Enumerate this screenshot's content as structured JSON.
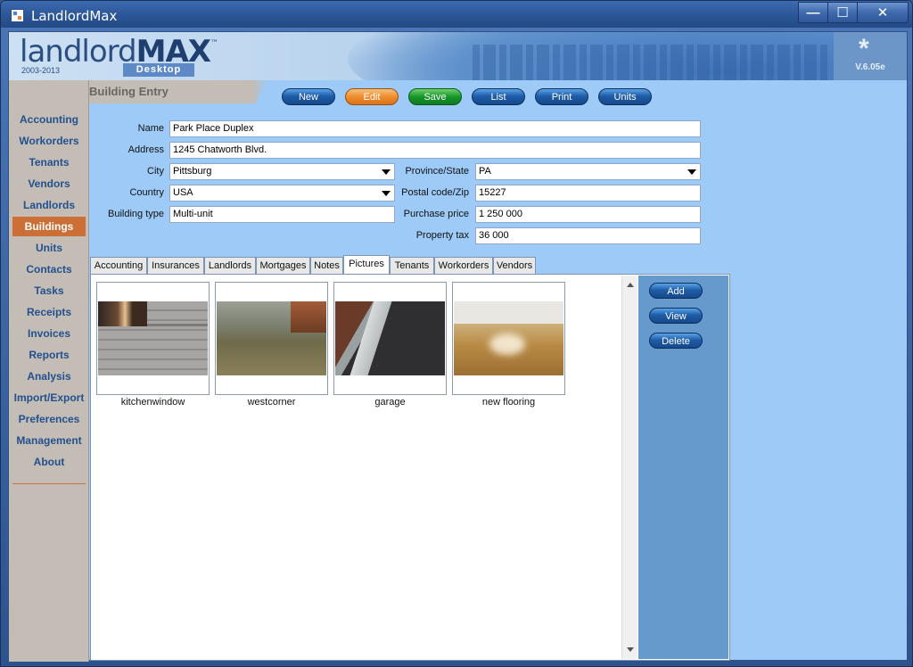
{
  "window": {
    "title": "LandlordMax",
    "minimize": "—",
    "maximize": "☐",
    "close": "✕"
  },
  "banner": {
    "logo_light": "landlord",
    "logo_bold": "MAX",
    "trademark": "™",
    "years": "2003-2013",
    "edition": "Desktop",
    "version_star": "*",
    "version": "V.6.05e"
  },
  "sidebar": {
    "items": [
      {
        "label": "Accounting"
      },
      {
        "label": "Workorders"
      },
      {
        "label": "Tenants"
      },
      {
        "label": "Vendors"
      },
      {
        "label": "Landlords"
      },
      {
        "label": "Buildings",
        "active": true
      },
      {
        "label": "Units"
      },
      {
        "label": "Contacts"
      },
      {
        "label": "Tasks"
      },
      {
        "label": "Receipts"
      },
      {
        "label": "Invoices"
      },
      {
        "label": "Reports"
      },
      {
        "label": "Analysis"
      },
      {
        "label": "Import/Export"
      },
      {
        "label": "Preferences"
      },
      {
        "label": "Management"
      },
      {
        "label": "About"
      }
    ]
  },
  "section": {
    "title": "Building Entry"
  },
  "toolbar": {
    "new": "New",
    "edit": "Edit",
    "save": "Save",
    "list": "List",
    "print": "Print",
    "units": "Units"
  },
  "form": {
    "name": {
      "label": "Name",
      "value": "Park Place Duplex"
    },
    "address": {
      "label": "Address",
      "value": "1245 Chatworth Blvd."
    },
    "city": {
      "label": "City",
      "value": "Pittsburg"
    },
    "province": {
      "label": "Province/State",
      "value": "PA"
    },
    "country": {
      "label": "Country",
      "value": "USA"
    },
    "postal": {
      "label": "Postal code/Zip",
      "value": "15227"
    },
    "building_type": {
      "label": "Building type",
      "value": "Multi-unit"
    },
    "purchase_price": {
      "label": "Purchase price",
      "value": "1 250 000"
    },
    "property_tax": {
      "label": "Property tax",
      "value": "36 000"
    }
  },
  "tabs": [
    {
      "label": "Accounting"
    },
    {
      "label": "Insurances"
    },
    {
      "label": "Landlords"
    },
    {
      "label": "Mortgages"
    },
    {
      "label": "Notes"
    },
    {
      "label": "Pictures",
      "active": true
    },
    {
      "label": "Tenants"
    },
    {
      "label": "Workorders"
    },
    {
      "label": "Vendors"
    }
  ],
  "pictures": [
    {
      "caption": "kitchenwindow",
      "icon": "photo"
    },
    {
      "caption": "westcorner",
      "icon": "photo"
    },
    {
      "caption": "garage",
      "icon": "photo"
    },
    {
      "caption": "new flooring",
      "icon": "photo"
    }
  ],
  "picture_actions": {
    "add": "Add",
    "view": "View",
    "delete": "Delete"
  },
  "colors": {
    "accent_active_nav": "#cc6f37",
    "client_background": "#9dcaf7",
    "sidebar_background": "#c3bdb5",
    "edit_button": "#ef8d2e",
    "save_button": "#16962a",
    "primary_button": "#1f5da8"
  }
}
